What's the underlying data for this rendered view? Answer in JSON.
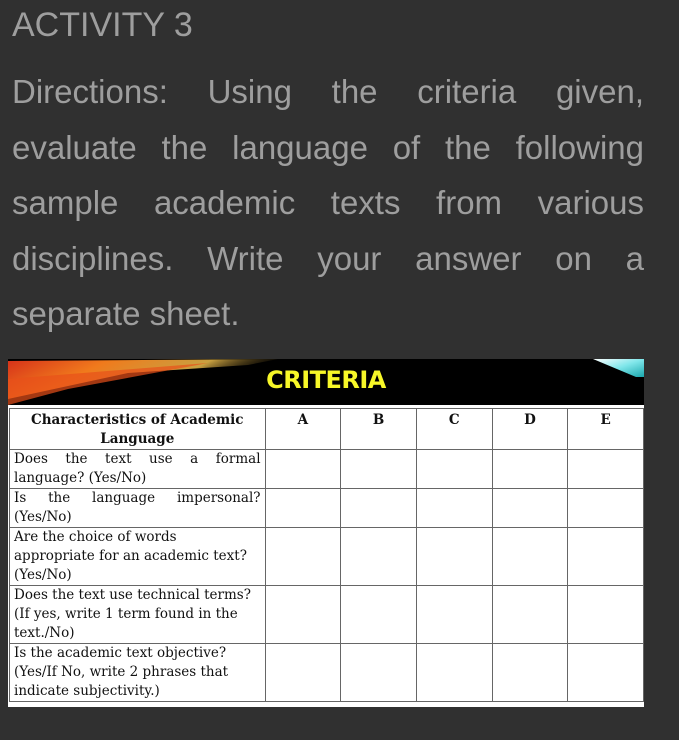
{
  "page": {
    "title": "ACTIVITY 3",
    "directions": "Directions: Using the criteria given, evaluate the language of the following sample academic texts from various disciplines. Write your answer on a separate sheet."
  },
  "document": {
    "banner_title": "CRITERIA",
    "colors": {
      "banner_bg": "#000000",
      "banner_text": "#f7f728",
      "accent_cyan": "#3fc9d0",
      "accent_orange": "#e8501a"
    },
    "table": {
      "headers": [
        "Characteristics of Academic Language",
        "A",
        "B",
        "C",
        "D",
        "E"
      ],
      "rows": [
        {
          "criterion": "Does the text use a formal language? (Yes/No)",
          "cells": [
            "",
            "",
            "",
            "",
            ""
          ]
        },
        {
          "criterion": "Is the language impersonal? (Yes/No)",
          "cells": [
            "",
            "",
            "",
            "",
            ""
          ]
        },
        {
          "criterion": "Are the choice of words appropriate for an academic text? (Yes/No)",
          "cells": [
            "",
            "",
            "",
            "",
            ""
          ]
        },
        {
          "criterion": "Does the text use technical terms? (If yes, write 1 term found in the text./No)",
          "cells": [
            "",
            "",
            "",
            "",
            ""
          ]
        },
        {
          "criterion": "Is the academic text objective? (Yes/If No, write 2 phrases that indicate subjectivity.)",
          "cells": [
            "",
            "",
            "",
            "",
            ""
          ]
        }
      ]
    }
  }
}
